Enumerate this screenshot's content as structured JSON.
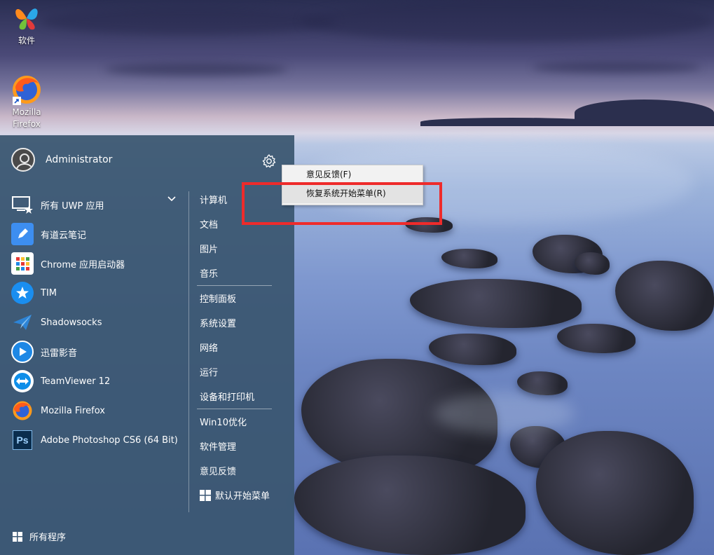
{
  "desktop": {
    "icons": [
      {
        "label": "软件",
        "icon": "software-butterfly-icon"
      },
      {
        "label": "Mozilla Firefox",
        "line1": "Mozilla",
        "line2": "Firefox",
        "icon": "firefox-icon"
      }
    ]
  },
  "start_menu": {
    "user": {
      "name": "Administrator",
      "icon": "user-avatar-icon"
    },
    "settings_icon": "gear-icon",
    "apps": [
      {
        "label": "所有 UWP 应用",
        "icon": "uwp-apps-icon",
        "color": "#ffffff"
      },
      {
        "label": "有道云笔记",
        "icon": "youdao-note-icon",
        "color": "#3d8ef0"
      },
      {
        "label": "Chrome 应用启动器",
        "icon": "chrome-launcher-icon",
        "color": "#ffffff"
      },
      {
        "label": "TIM",
        "icon": "tim-icon",
        "color": "#1a8ef0"
      },
      {
        "label": "Shadowsocks",
        "icon": "shadowsocks-icon",
        "color": "#2d84d6"
      },
      {
        "label": "迅雷影音",
        "icon": "xunlei-player-icon",
        "color": "#1e88e5"
      },
      {
        "label": "TeamViewer 12",
        "icon": "teamviewer-icon",
        "color": "#0e8ee9"
      },
      {
        "label": "Mozilla Firefox",
        "icon": "firefox-icon",
        "color": "#ff7a1a"
      },
      {
        "label": "Adobe Photoshop CS6 (64 Bit)",
        "icon": "photoshop-icon",
        "color": "#0a2d4d"
      }
    ],
    "links_group1": [
      "计算机",
      "文档",
      "图片",
      "音乐"
    ],
    "links_group2": [
      "控制面板",
      "系统设置",
      "网络",
      "运行",
      "设备和打印机"
    ],
    "links_group3": [
      "Win10优化",
      "软件管理",
      "意见反馈",
      "默认开始菜单"
    ],
    "all_programs": "所有程序"
  },
  "context_menu": {
    "items": [
      "意见反馈(F)",
      "恢复系统开始菜单(R)"
    ]
  },
  "colors": {
    "start_bg": "#3a5670",
    "highlight": "#ee2b2b"
  }
}
